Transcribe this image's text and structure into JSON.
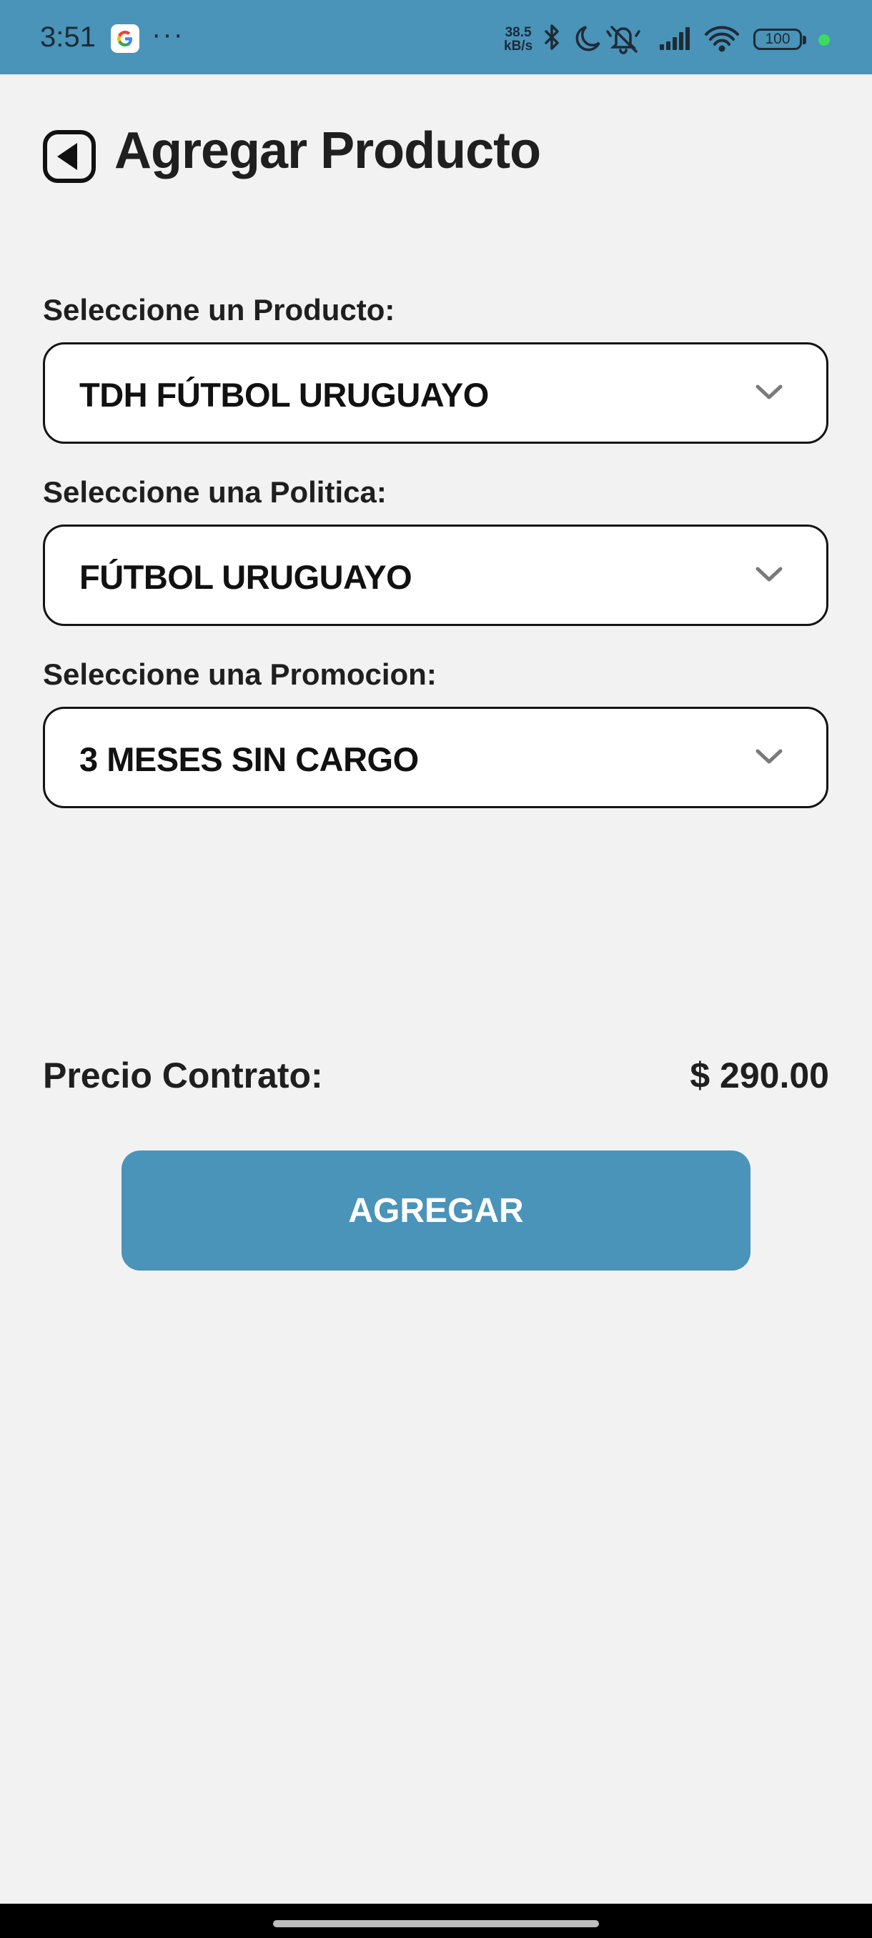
{
  "status_bar": {
    "time": "3:51",
    "notification_dots": "···",
    "net_speed_value": "38.5",
    "net_speed_unit": "kB/s",
    "battery": "100",
    "icons": [
      "google-icon",
      "bluetooth-icon",
      "moon-icon",
      "mute-icon",
      "signal-icon",
      "wifi-icon",
      "battery-icon"
    ],
    "accent_color": "#4a93b9"
  },
  "header": {
    "title": "Agregar Producto",
    "back_icon": "back-arrow-icon"
  },
  "form": {
    "product": {
      "label": "Seleccione un Producto:",
      "value": "TDH FÚTBOL URUGUAYO"
    },
    "policy": {
      "label": "Seleccione una Politica:",
      "value": "FÚTBOL URUGUAYO"
    },
    "promotion": {
      "label": "Seleccione una Promocion:",
      "value": "3 MESES SIN CARGO"
    }
  },
  "price": {
    "label": "Precio Contrato:",
    "value": "$ 290.00"
  },
  "actions": {
    "add_label": "AGREGAR",
    "button_color": "#4a93b9"
  }
}
